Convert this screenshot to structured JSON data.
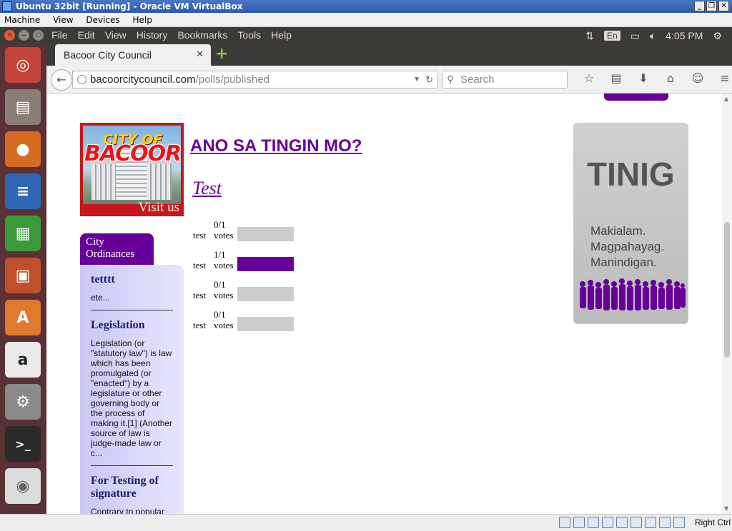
{
  "vbox": {
    "title": "Ubuntu 32bit [Running] - Oracle VM VirtualBox",
    "menu": [
      "Machine",
      "View",
      "Devices",
      "Help"
    ],
    "host_key": "Right Ctrl"
  },
  "ubuntu_panel": {
    "menu": [
      "File",
      "Edit",
      "View",
      "History",
      "Bookmarks",
      "Tools",
      "Help"
    ],
    "keyboard": "En",
    "clock": "4:05 PM"
  },
  "launcher": [
    "dash-home",
    "files",
    "firefox",
    "libreoffice-writer",
    "libreoffice-calc",
    "libreoffice-impress",
    "software-center",
    "amazon",
    "system-settings",
    "terminal",
    "dvd"
  ],
  "browser": {
    "tab_title": "Bacoor City Council",
    "url_host": "bacoorcitycouncil.com",
    "url_path": "/polls/published",
    "search_placeholder": "Search"
  },
  "page": {
    "logo": {
      "city_of": "CITY OF",
      "bacoor": "BACOOR",
      "visit": "Visit us"
    },
    "poll_title": "ANO SA TINGIN MO?",
    "poll_question": "Test",
    "options": [
      {
        "count": "0/1",
        "label": "test",
        "votes": "votes",
        "fraction": 0
      },
      {
        "count": "1/1",
        "label": "test",
        "votes": "votes",
        "fraction": 1
      },
      {
        "count": "0/1",
        "label": "test",
        "votes": "votes",
        "fraction": 0
      },
      {
        "count": "0/1",
        "label": "test",
        "votes": "votes",
        "fraction": 0
      }
    ],
    "sidebar": {
      "tab": "City Ordinances",
      "items": [
        {
          "title": "tetttt",
          "excerpt": "ete..."
        },
        {
          "title": "Legislation",
          "excerpt": "Legislation (or \"statutory law\") is law which has been promulgated (or \"enacted\") by a legislature or other governing body or the process of making it.[1] (Another source of law is judge-made law or c..."
        },
        {
          "title": "For Testing of signature",
          "excerpt": "Contrary to popular"
        }
      ]
    },
    "ad": {
      "word": "TINIG",
      "slogan": [
        "Makialam.",
        "Magpahayag.",
        "Manindigan."
      ]
    }
  },
  "colors": {
    "accent": "#660099",
    "bar_empty": "#cccccc"
  }
}
